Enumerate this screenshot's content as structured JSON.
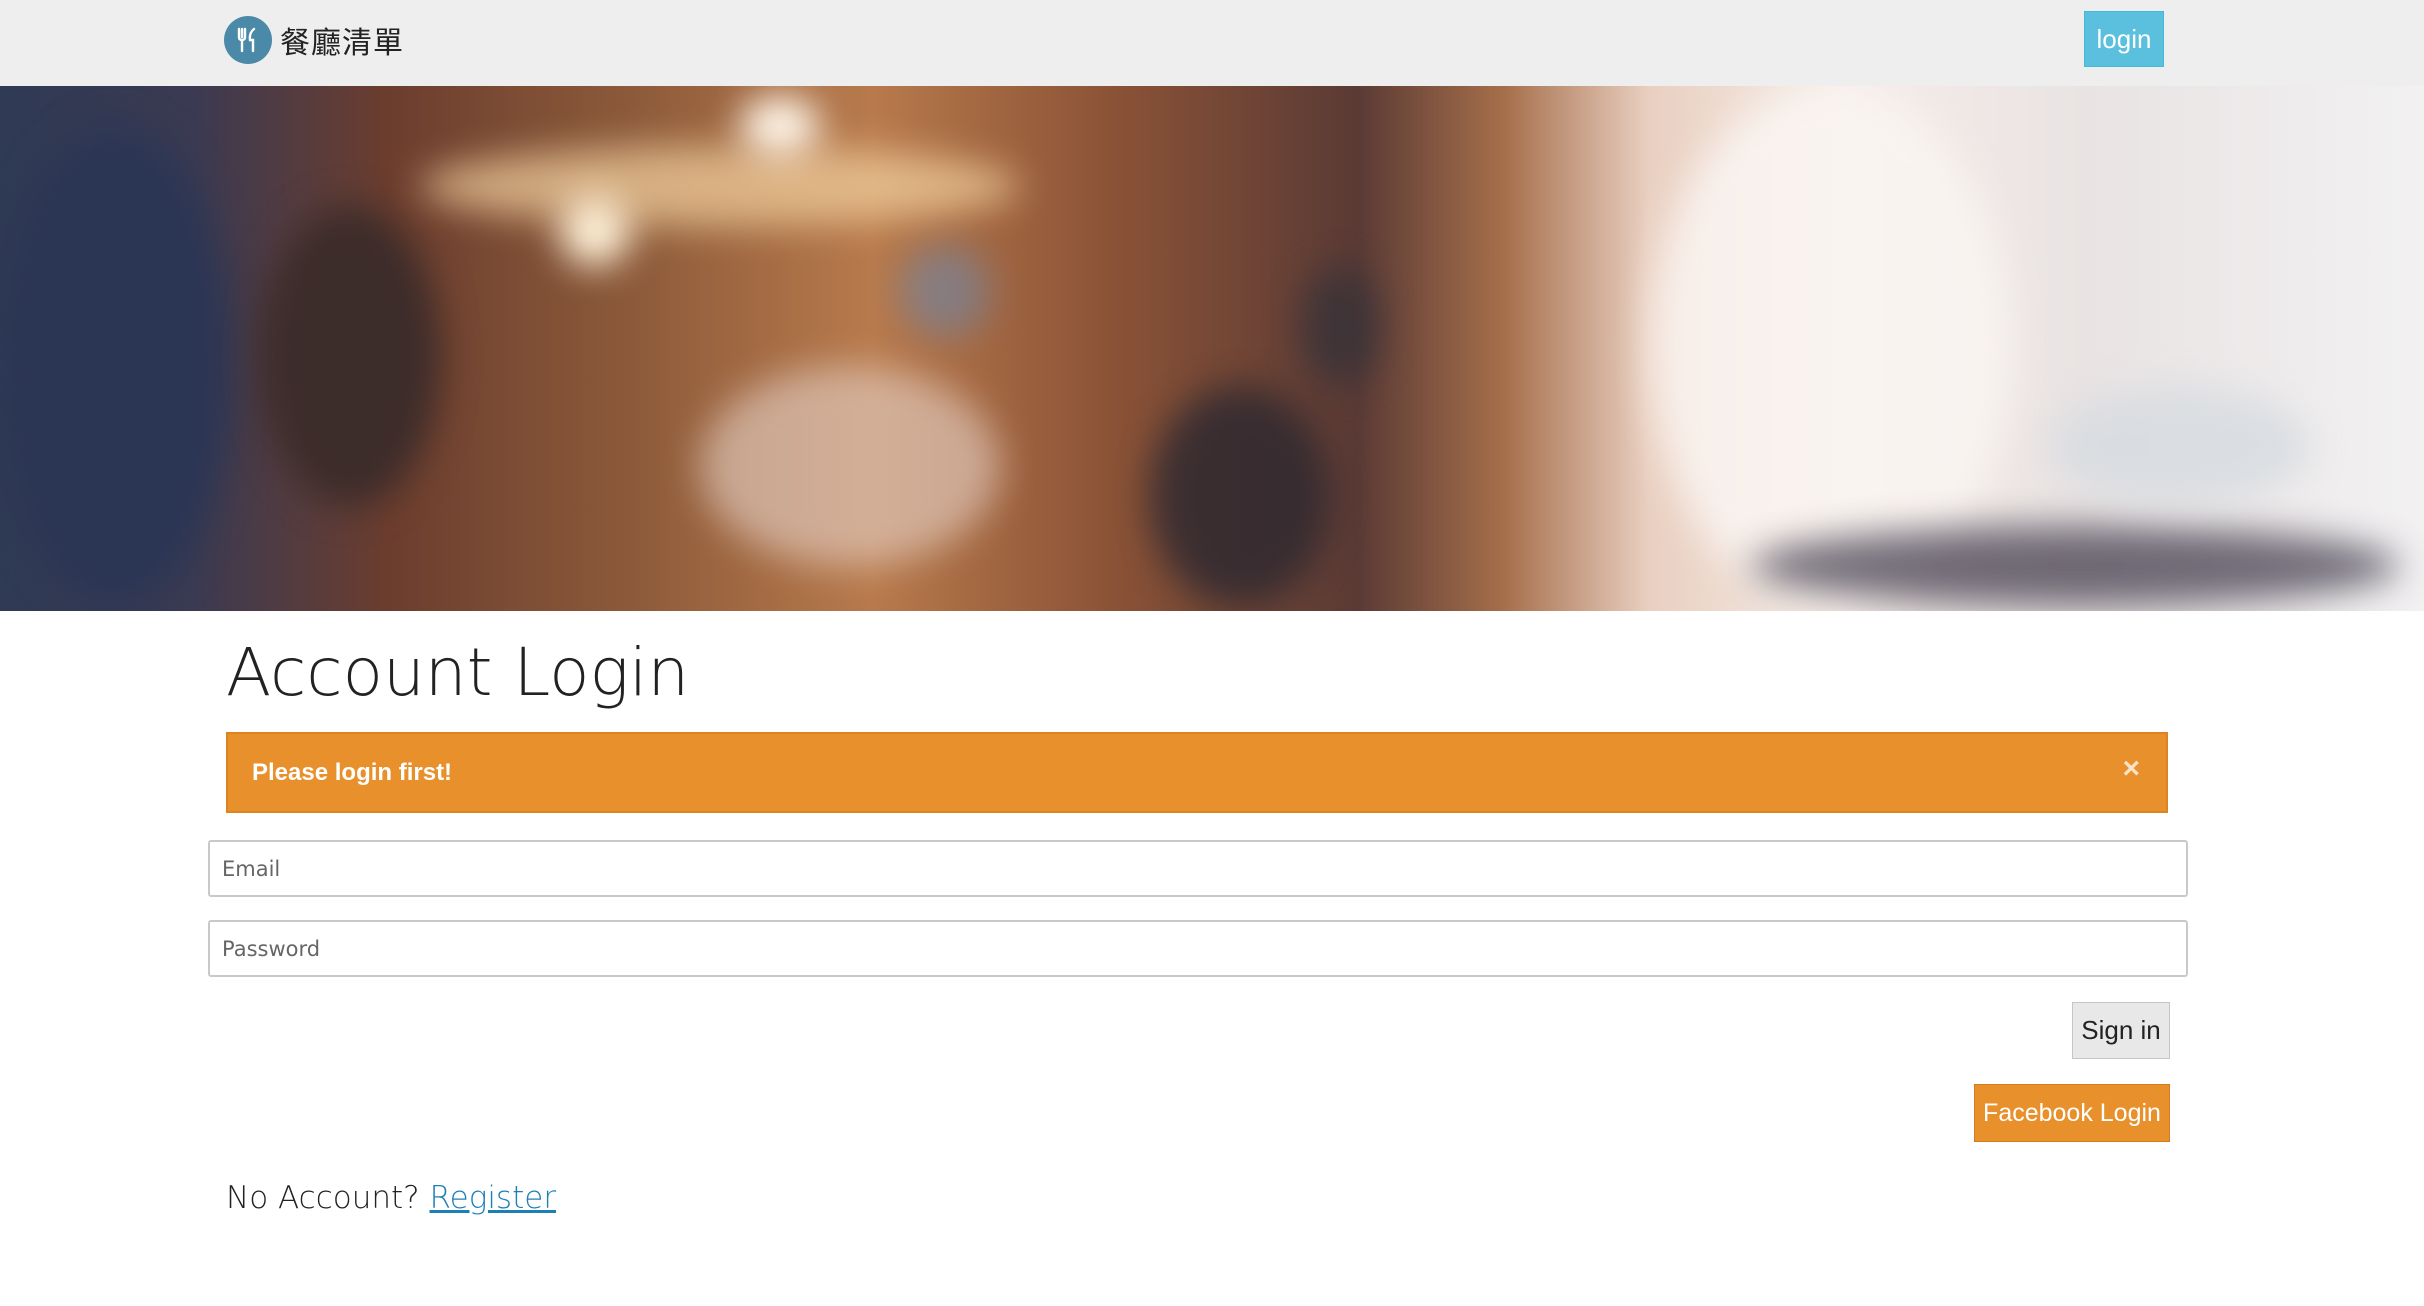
{
  "navbar": {
    "brand_name": "餐廳清單",
    "login_label": "login"
  },
  "page": {
    "title": "Account Login"
  },
  "alert": {
    "message": "Please login first!",
    "close_symbol": "×"
  },
  "form": {
    "email_placeholder": "Email",
    "password_placeholder": "Password",
    "signin_label": "Sign in",
    "facebook_label": "Facebook Login"
  },
  "footer": {
    "no_account_text": "No Account?",
    "register_label": "Register"
  },
  "icons": {
    "brand": "utensils-icon",
    "close": "close-icon"
  },
  "colors": {
    "accent_orange": "#e8902b",
    "login_button": "#5bc0de",
    "link": "#1d7fb5",
    "brand_logo": "#4a8aa8"
  }
}
